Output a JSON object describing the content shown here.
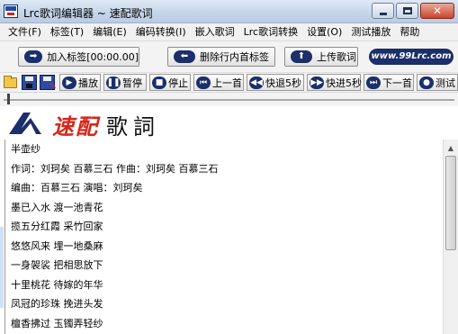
{
  "window": {
    "title": "Lrc歌词编辑器 ~ 速配歌词",
    "close_glyph": "✕"
  },
  "menu": [
    "文件(F)",
    "标签(T)",
    "编辑(E)",
    "编码转换(I)",
    "嵌入歌词",
    "Lrc歌词转换",
    "设置(O)",
    "测试播放",
    "帮助"
  ],
  "toolbar1": {
    "add_tag": "加入标签[00:00.00]",
    "delete_first_tag": "删除行内首标签",
    "upload_lyrics": "上传歌词",
    "website": "www.99Lrc.com"
  },
  "toolbar2": {
    "play": "播放",
    "pause": "暂停",
    "stop": "停止",
    "previous": "上一首",
    "fast_back": "快退5秒",
    "fast_forward": "快进5秒",
    "next": "下一首",
    "test": "测试"
  },
  "logo": {
    "speed_text": "速配",
    "lyrics_text": "歌詞"
  },
  "lyrics": [
    "半壶纱",
    "作词：刘珂矣 百慕三石 作曲：刘珂矣 百慕三石",
    "编曲：百慕三石 演唱：刘珂矣",
    "墨已入水 渡一池青花",
    "揽五分红霞 采竹回家",
    "悠悠风来 埋一地桑麻",
    "一身袈裟 把相思放下",
    "十里桃花 待嫁的年华",
    "凤冠的珍珠 挽进头发",
    "檀香拂过 玉镯弄轻纱"
  ],
  "colors": {
    "brand_navy": "#1b2f6a",
    "logo_red": "#d5261a"
  }
}
